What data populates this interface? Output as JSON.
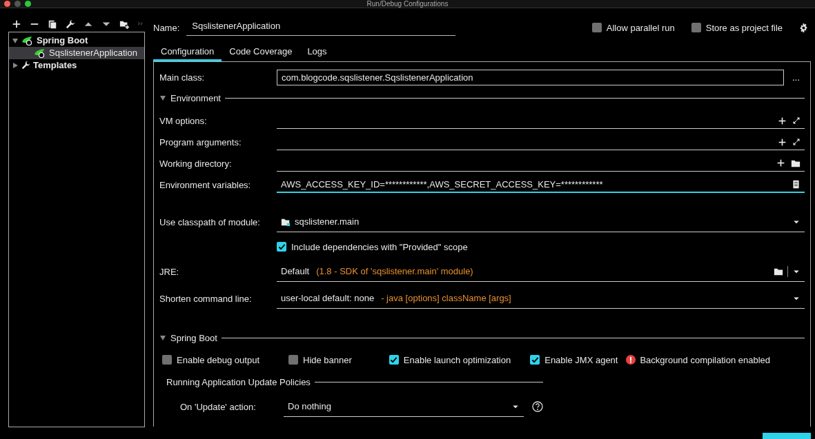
{
  "window": {
    "title": "Run/Debug Configurations"
  },
  "tree": [
    {
      "label": "Spring Boot",
      "expanded": true,
      "selected": false,
      "children": [
        {
          "label": "SqslistenerApplication",
          "selected": true
        }
      ]
    },
    {
      "label": "Templates",
      "expanded": false,
      "selected": false
    }
  ],
  "name": {
    "label": "Name:",
    "value": "SqslistenerApplication"
  },
  "header_options": [
    {
      "label": "Allow parallel run",
      "checked": false
    },
    {
      "label": "Store as project file",
      "checked": false
    }
  ],
  "tabs": [
    {
      "label": "Configuration",
      "selected": true
    },
    {
      "label": "Code Coverage",
      "selected": false
    },
    {
      "label": "Logs",
      "selected": false
    }
  ],
  "main_class": {
    "label": "Main class:",
    "value": "com.blogcode.sqslistener.SqslistenerApplication",
    "browse": "..."
  },
  "environment": {
    "title": "Environment",
    "expanded": true,
    "fields": [
      {
        "kind": "options",
        "label": "VM options:",
        "focused": false
      },
      {
        "kind": "options",
        "label": "Program arguments:",
        "focused": false
      },
      {
        "kind": "directory",
        "label": "Working directory:",
        "focused": false
      },
      {
        "kind": "variables",
        "label": "Environment variables:",
        "value": "AWS_ACCESS_KEY_ID=************,AWS_SECRET_ACCESS_KEY=************",
        "focused": true
      }
    ]
  },
  "settings": [
    {
      "kind": "module",
      "label": "Use classpath of module:",
      "value": "sqslistener.main"
    },
    {
      "kind": "checkbox",
      "label": "Include dependencies with \"Provided\" scope",
      "checked": true
    },
    {
      "kind": "jre",
      "label": "JRE:",
      "value": "Default",
      "hint": "(1.8 - SDK of 'sqslistener.main' module)"
    },
    {
      "kind": "select",
      "label": "Shorten command line:",
      "value": "user-local default: none",
      "hint": "- java [options] className [args]"
    }
  ],
  "spring_boot": {
    "title": "Spring Boot",
    "expanded": true,
    "options": [
      {
        "label": "Enable debug output",
        "checked": false
      },
      {
        "label": "Hide banner",
        "checked": false
      },
      {
        "label": "Enable launch optimization",
        "checked": true
      },
      {
        "label": "Enable JMX agent",
        "checked": true
      }
    ],
    "warning": "Background compilation enabled",
    "policies": {
      "title": "Running Application Update Policies",
      "rows": [
        {
          "label": "On 'Update' action:",
          "value": "Do nothing"
        }
      ]
    }
  }
}
